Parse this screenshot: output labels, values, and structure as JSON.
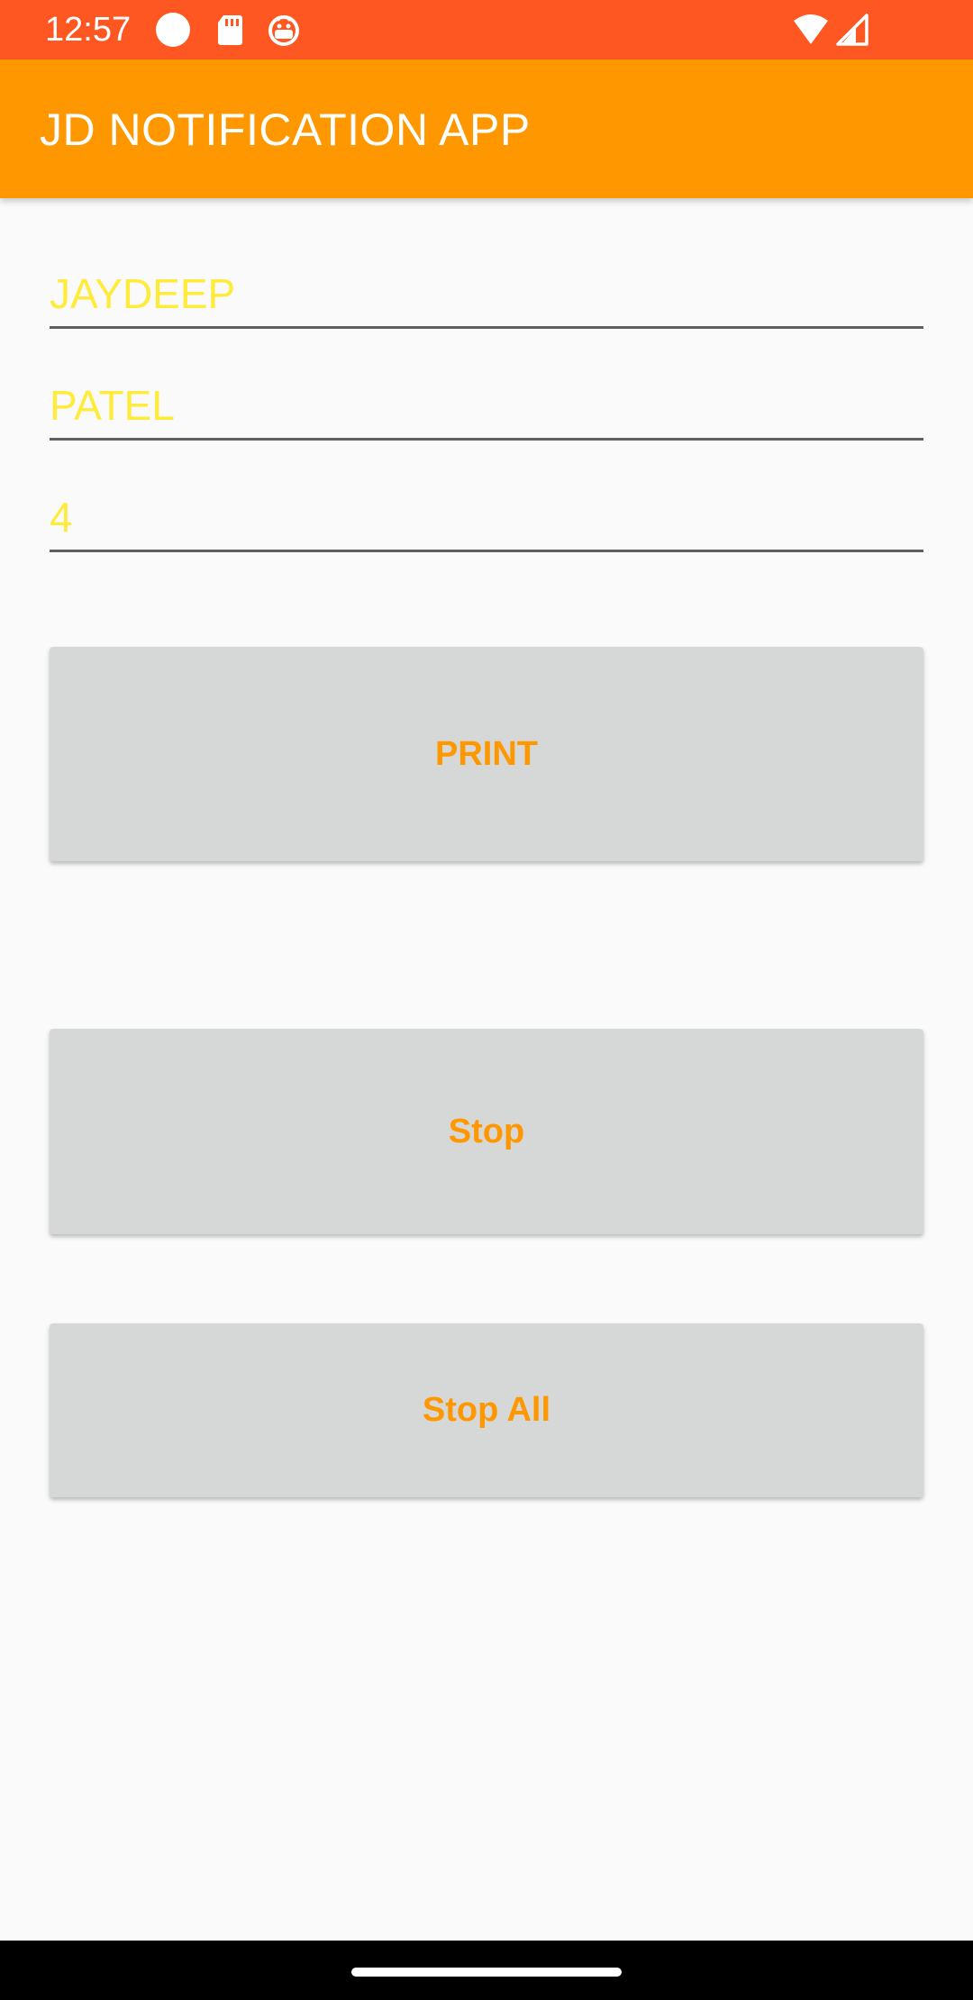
{
  "status_bar": {
    "time": "12:57",
    "icons": [
      "circle-icon",
      "sd-card-icon",
      "android-debug-icon",
      "wifi-icon",
      "signal-icon"
    ]
  },
  "app_bar": {
    "title": "JD NOTIFICATION APP"
  },
  "form": {
    "first_name": {
      "value": "JAYDEEP",
      "placeholder": ""
    },
    "last_name": {
      "value": "PATEL",
      "placeholder": ""
    },
    "number": {
      "value": "4",
      "placeholder": ""
    }
  },
  "buttons": {
    "print_label": "PRINT",
    "stop_label": "Stop",
    "stop_all_label": "Stop All"
  },
  "colors": {
    "status_bar": "#ff5722",
    "app_bar": "#ff9800",
    "field_text": "#ffeb3b",
    "button_bg": "#d6d7d7",
    "button_text": "#ff9800"
  }
}
